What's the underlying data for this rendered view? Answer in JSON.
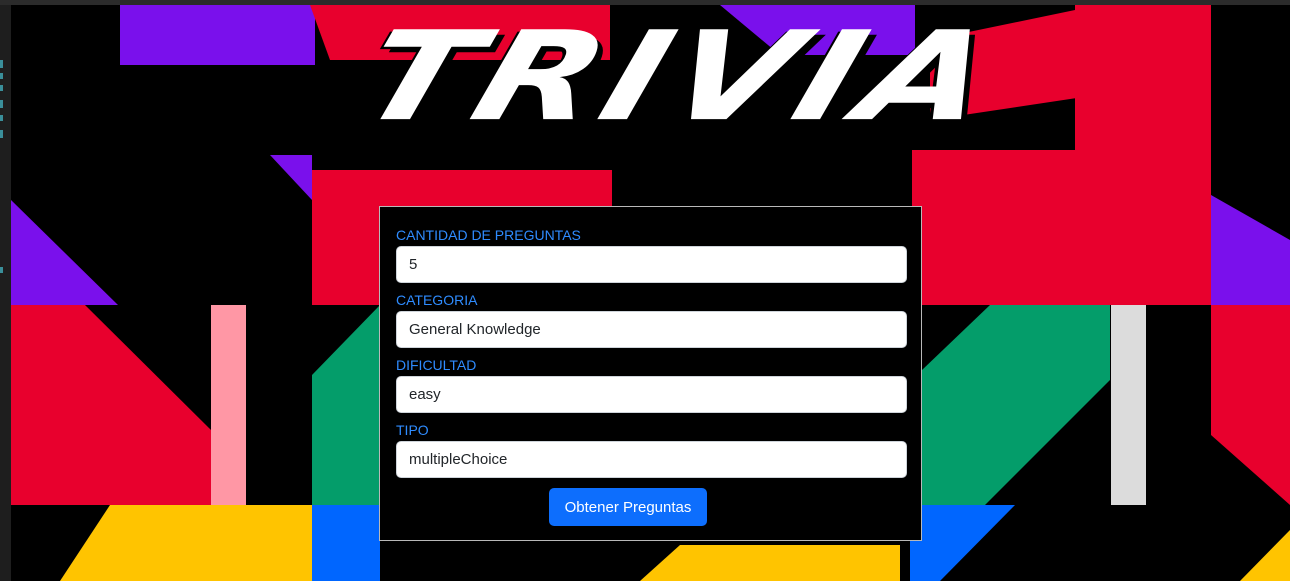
{
  "logo": {
    "text": "TRIVIA"
  },
  "form": {
    "fields": [
      {
        "label": "CANTIDAD DE PREGUNTAS",
        "value": "5"
      },
      {
        "label": "CATEGORIA",
        "value": "General Knowledge"
      },
      {
        "label": "DIFICULTAD",
        "value": "easy"
      },
      {
        "label": "TIPO",
        "value": "multipleChoice"
      }
    ],
    "submit_label": "Obtener Preguntas"
  },
  "colors": {
    "background": "#000000",
    "red": "#e8002d",
    "purple": "#7a10ec",
    "green": "#049d6a",
    "yellow": "#ffc400",
    "blue": "#0066ff",
    "pink": "#ff97a5",
    "light_gray": "#dcdcdc",
    "label_blue": "#2f8cff",
    "button_blue": "#0d6efd"
  }
}
